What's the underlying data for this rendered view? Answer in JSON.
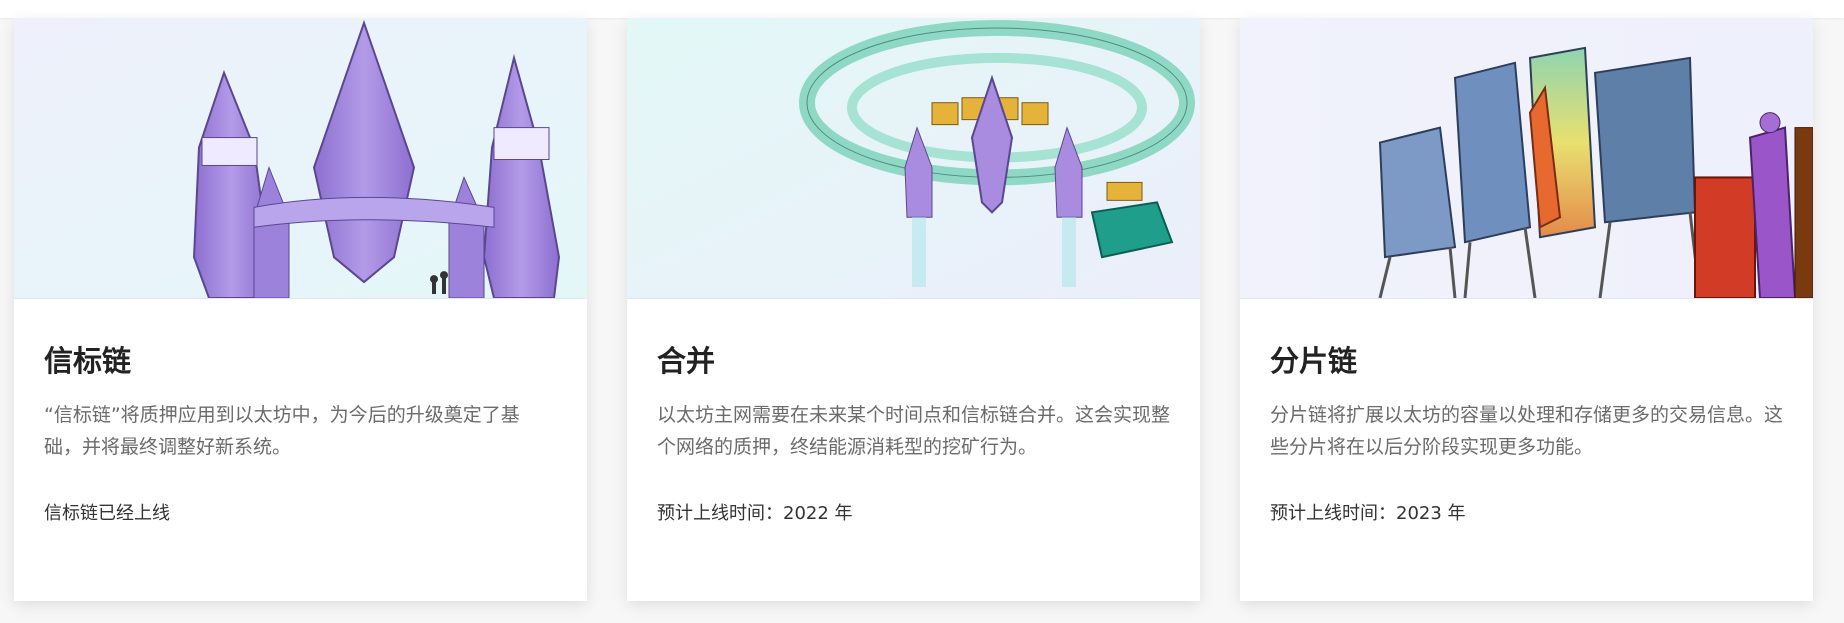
{
  "cards": [
    {
      "title": "信标链",
      "description": "“信标链”将质押应用到以太坊中，为今后的升级奠定了基础，并将最终调整好新系统。",
      "status": "信标链已经上线",
      "image_icon": "rocket-ship-illustration"
    },
    {
      "title": "合并",
      "description": "以太坊主网需要在未来某个时间点和信标链合并。这会实现整个网络的质押，终结能源消耗型的挖矿行为。",
      "status": "预计上线时间：2022 年",
      "image_icon": "merge-ring-illustration"
    },
    {
      "title": "分片链",
      "description": "分片链将扩展以太坊的容量以处理和存储更多的交易信息。这些分片将在以后分阶段实现更多功能。",
      "status": "预计上线时间：2023 年",
      "image_icon": "shard-chain-illustration"
    }
  ],
  "colors": {
    "title": "#222222",
    "description": "#6b6b6b",
    "ship_purple": "#a98be0",
    "ring_teal": "#8fd9c4",
    "shard_blue": "#6f8fbf"
  }
}
